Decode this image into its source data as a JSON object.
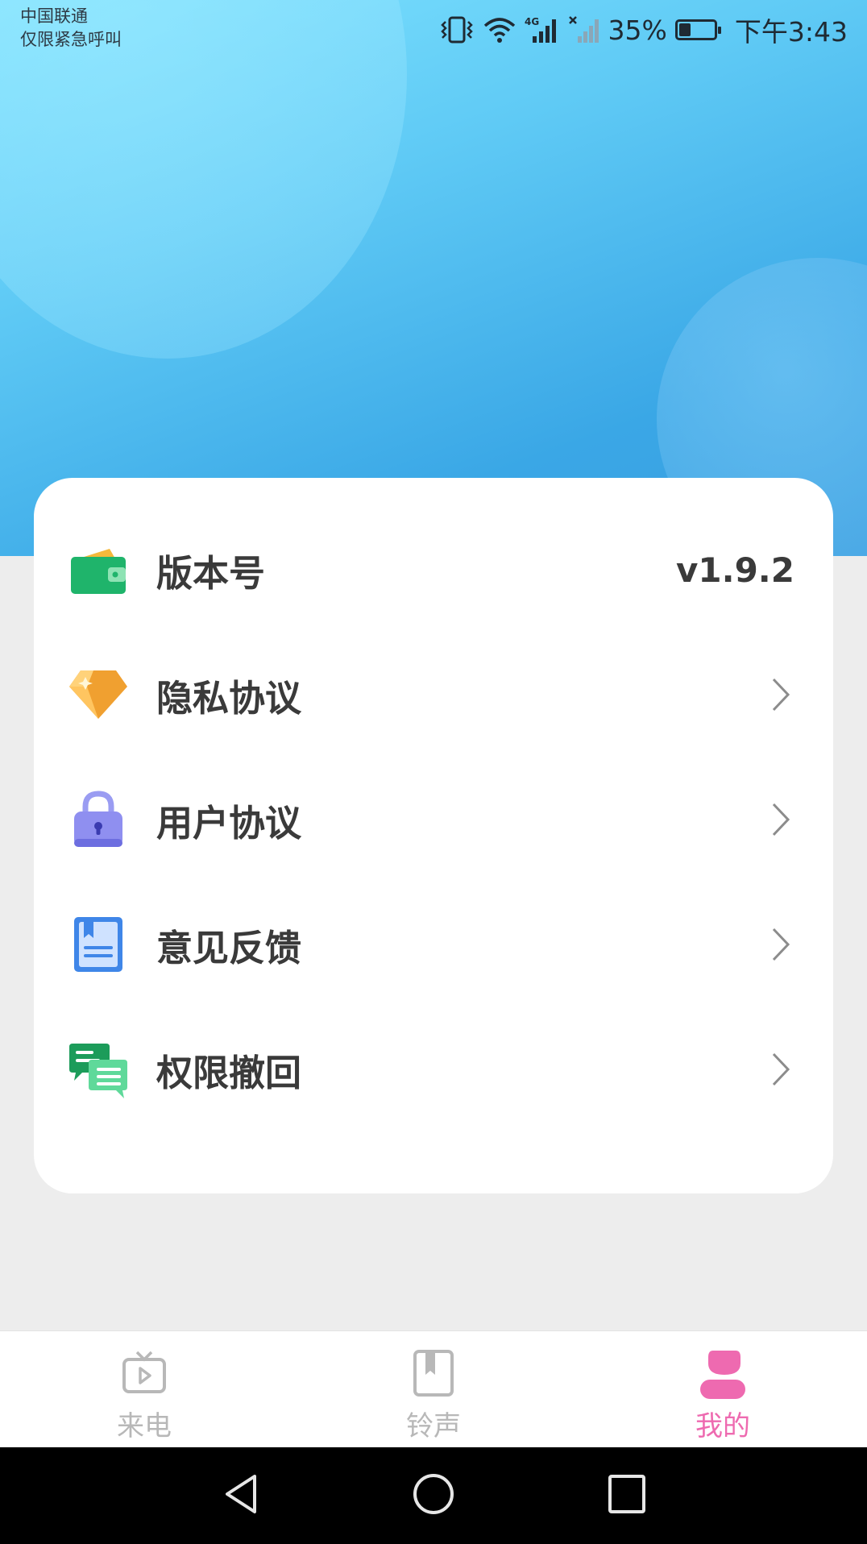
{
  "status_bar": {
    "carrier_line1": "中国联通",
    "carrier_line2": "仅限紧急呼叫",
    "battery_percent": "35%",
    "battery_level": 0.35,
    "time": "下午3:43",
    "icons": [
      "vibrate-icon",
      "wifi-icon",
      "4g-signal-icon",
      "no-signal-icon",
      "battery-icon"
    ]
  },
  "settings": {
    "items": [
      {
        "label": "版本号",
        "value": "v1.9.2",
        "icon": "wallet-icon"
      },
      {
        "label": "隐私协议",
        "icon": "diamond-icon"
      },
      {
        "label": "用户协议",
        "icon": "lock-icon"
      },
      {
        "label": "意见反馈",
        "icon": "notebook-icon"
      },
      {
        "label": "权限撤回",
        "icon": "chat-icon"
      }
    ]
  },
  "bottom_nav": {
    "tabs": [
      {
        "label": "来电",
        "icon": "tv-play-icon",
        "active": false
      },
      {
        "label": "铃声",
        "icon": "bookmark-book-icon",
        "active": false
      },
      {
        "label": "我的",
        "icon": "user-icon",
        "active": true
      }
    ],
    "active_color": "#ee6ab0",
    "inactive_color": "#b8b8b8"
  },
  "system_nav": {
    "buttons": [
      "back-icon",
      "home-icon",
      "recents-icon"
    ]
  }
}
